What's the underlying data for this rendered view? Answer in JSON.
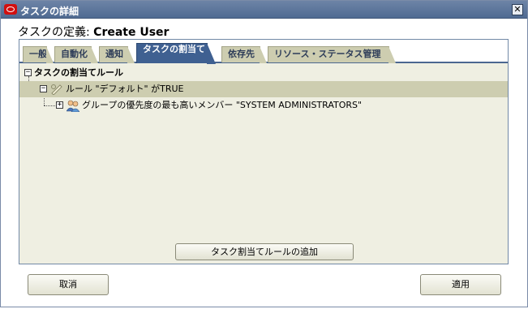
{
  "window": {
    "title": "タスクの詳細",
    "close_symbol": "✕"
  },
  "header": {
    "label": "タスクの定義: ",
    "task_name": "Create User"
  },
  "tabs": [
    {
      "label": "一般",
      "active": false
    },
    {
      "label": "自動化",
      "active": false
    },
    {
      "label": "通知",
      "active": false
    },
    {
      "label": "タスクの割当て",
      "active": true
    },
    {
      "label": "依存先",
      "active": false
    },
    {
      "label": "リソース・ステータス管理",
      "active": false
    }
  ],
  "tree": {
    "root_label": "タスクの割当てルール",
    "rule_label": "ルール \"デフォルト\" がTRUE",
    "group_label": "グループの優先度の最も高いメンバー \"SYSTEM ADMINISTRATORS\"",
    "expanded_symbol": "−",
    "collapsed_symbol": "+"
  },
  "add_rule_button": "タスク割当てルールの追加",
  "buttons": {
    "cancel": "取消",
    "apply": "適用"
  },
  "colors": {
    "accent": "#3f6091",
    "panel": "#efefe2",
    "tab": "#cdcdb0"
  }
}
